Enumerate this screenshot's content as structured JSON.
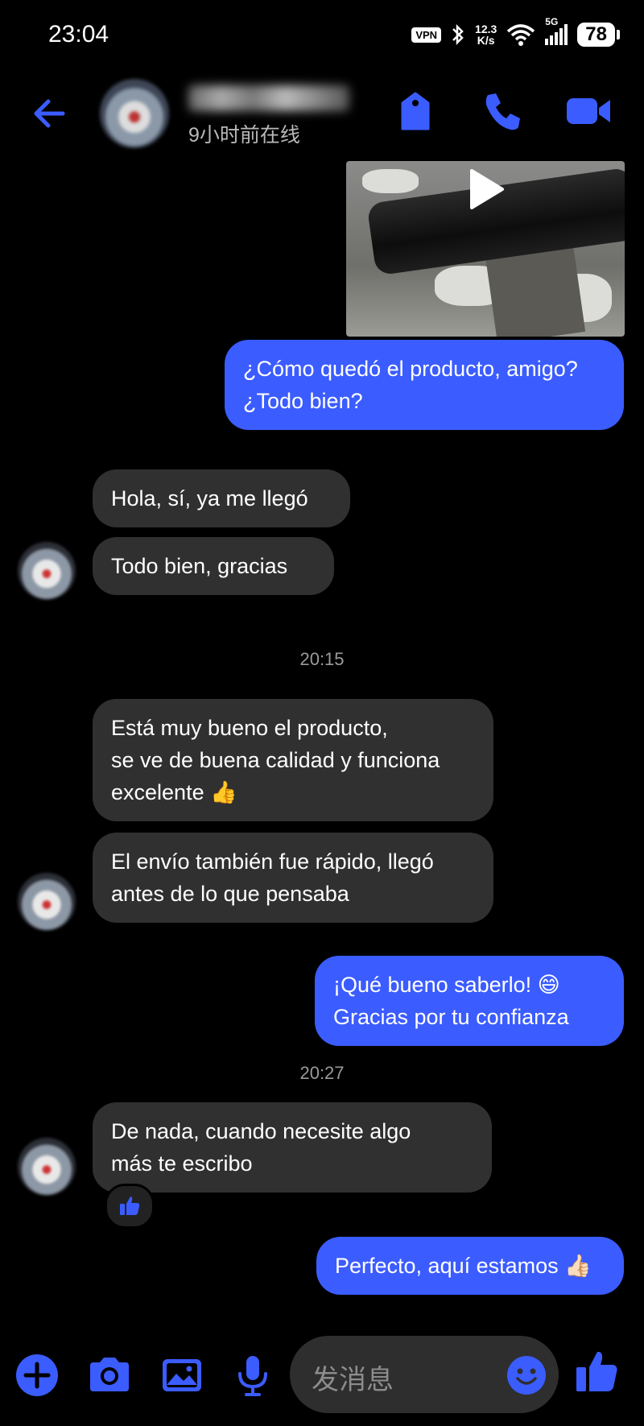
{
  "status_bar": {
    "time": "23:04",
    "vpn": "VPN",
    "net_speed_value": "12.3",
    "net_speed_unit": "K/s",
    "network": "5G",
    "battery": "78"
  },
  "header": {
    "last_seen": "9小时前在线",
    "icons": [
      "back-arrow-icon",
      "tag-icon",
      "phone-icon",
      "video-camera-icon"
    ]
  },
  "messages": {
    "m1": "¿Cómo quedó el producto, amigo?\n¿Todo bien?",
    "m2": "Hola, sí, ya me llegó",
    "m3": "Todo bien, gracias",
    "ts1": "20:15",
    "m4": "Está muy bueno el producto,\nse ve de buena calidad y funciona\nexcelente 👍",
    "m5": "El envío también fue rápido, llegó\nantes de lo que pensaba",
    "m6": "¡Qué bueno saberlo! 😄\nGracias por tu confianza",
    "ts2": "20:27",
    "m7": "De nada, cuando necesite algo\nmás te escribo",
    "m8": "Perfecto, aquí estamos 👍🏻"
  },
  "composer": {
    "placeholder": "发消息",
    "icons": [
      "plus-icon",
      "camera-icon",
      "image-icon",
      "microphone-icon",
      "emoji-icon",
      "thumbs-up-icon"
    ]
  },
  "colors": {
    "accent": "#3b5cff",
    "incoming_bubble": "#303030",
    "background": "#000000"
  }
}
